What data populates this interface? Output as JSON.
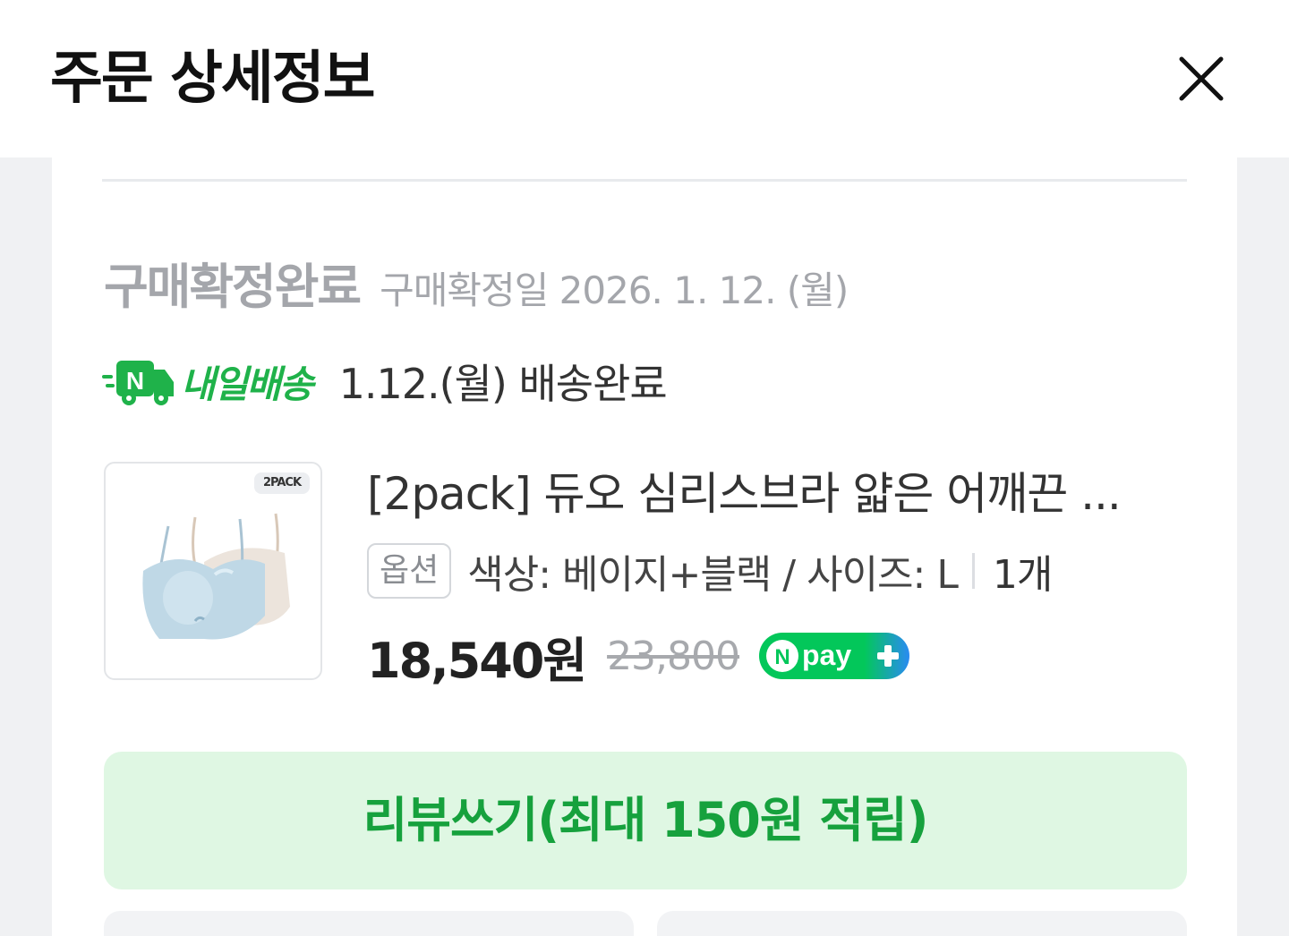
{
  "header": {
    "title": "주문 상세정보",
    "close_icon": "close-icon"
  },
  "order": {
    "status": "구매확정완료",
    "confirm_date": "구매확정일 2026. 1. 12. (월)"
  },
  "delivery": {
    "brand": "내일배송",
    "brand_icon": "truck-n-icon",
    "status": "1.12.(월) 배송완료"
  },
  "product": {
    "badge": "2PACK",
    "name": "[2pack] 듀오 심리스브라 얇은 어깨끈 ...",
    "option_label": "옵션",
    "option_text": "색상: 베이지+블랙 / 사이즈: L",
    "quantity": "1개",
    "price": "18,540원",
    "original_price": "23,800",
    "npay_label": "pay"
  },
  "review_button": {
    "label": "리뷰쓰기(최대 150원 적립)"
  },
  "colors": {
    "accent_green": "#1fb24a",
    "review_bg": "#dff7e3",
    "review_text": "#16a13d",
    "status_gray": "#a4a6ab"
  }
}
